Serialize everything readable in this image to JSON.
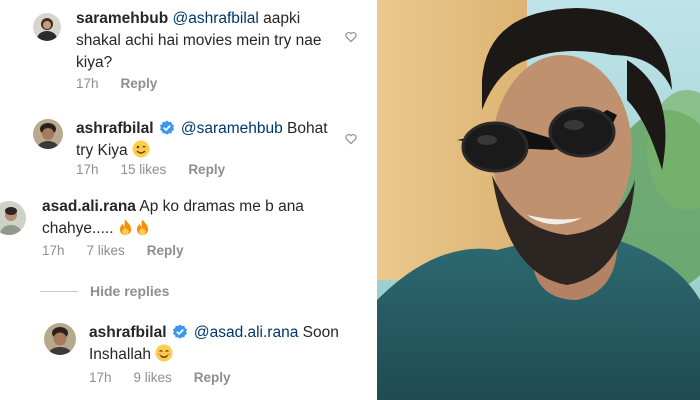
{
  "comments": [
    {
      "username": "saramehbub",
      "mention": "@ashrafbilal",
      "text": " aapki shakal achi hai movies mein try nae kiya?",
      "time": "17h",
      "reply_label": "Reply"
    },
    {
      "username": "ashrafbilal",
      "verified": true,
      "mention": "@saramehbub",
      "text": " Bohat try Kiya",
      "emoji": "winking-face",
      "time": "17h",
      "likes": "15 likes",
      "reply_label": "Reply"
    },
    {
      "username": "asad.ali.rana",
      "text": " Ap ko dramas me b ana chahye.....",
      "emoji": "fire x2",
      "time": "17h",
      "likes": "7 likes",
      "reply_label": "Reply"
    }
  ],
  "hide_replies_label": "Hide replies",
  "reply": {
    "username": "ashrafbilal",
    "verified": true,
    "mention": "@asad.ali.rana",
    "text": " Soon Inshallah",
    "emoji": "smiling-face",
    "time": "17h",
    "likes": "9 likes",
    "reply_label": "Reply"
  },
  "colors": {
    "username": "#262626",
    "mention": "#00376b",
    "meta": "#8e8e8e",
    "verified": "#3897f0"
  }
}
